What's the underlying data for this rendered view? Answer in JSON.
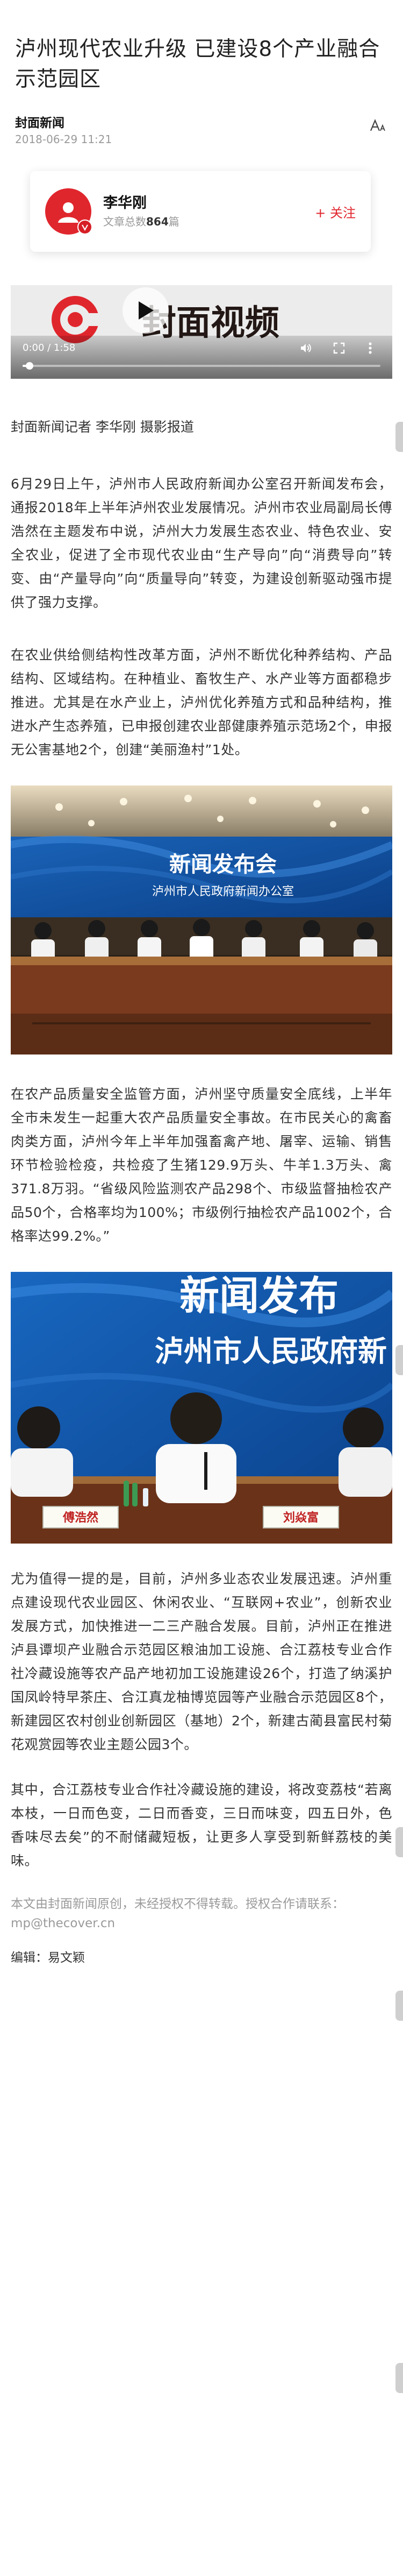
{
  "article": {
    "title": "泸州现代农业升级 已建设8个产业融合示范园区",
    "source": "封面新闻",
    "date": "2018-06-29 11:21"
  },
  "author_card": {
    "name": "李华刚",
    "article_count_prefix": "文章总数",
    "article_count": "864",
    "article_count_suffix": "篇",
    "follow_label": "+ 关注"
  },
  "video": {
    "logo_text": "封面视频",
    "time": "0:00 / 1:58",
    "progress": 0.02,
    "icons": [
      "play-icon",
      "volume-icon",
      "fullscreen-icon",
      "more-vertical-icon"
    ]
  },
  "body": {
    "reporter_line": "封面新闻记者 李华刚 摄影报道",
    "paragraphs": [
      "6月29日上午，泸州市人民政府新闻办公室召开新闻发布会，通报2018年上半年泸州农业发展情况。泸州市农业局副局长傅浩然在主题发布中说，泸州大力发展生态农业、特色农业、安全农业，促进了全市现代农业由“生产导向”向“消费导向”转变、由“产量导向”向“质量导向”转变，为建设创新驱动强市提供了强力支撑。",
      "在农业供给侧结构性改革方面，泸州不断优化种养结构、产品结构、区域结构。在种植业、畜牧生产、水产业等方面都稳步推进。尤其是在水产业上，泸州优化养殖方式和品种结构，推进水产生态养殖，已申报创建农业部健康养殖示范场2个，申报无公害基地2个，创建“美丽渔村”1处。",
      "在农产品质量安全监管方面，泸州坚守质量安全底线，上半年全市未发生一起重大农产品质量安全事故。在市民关心的禽畜肉类方面，泸州今年上半年加强畜禽产地、屠宰、运输、销售环节检验检疫，共检疫了生猪129.9万头、牛羊1.3万头、禽371.8万羽。“省级风险监测农产品298个、市级监督抽检农产品50个，合格率均为100%；市级例行抽检农产品1002个，合格率达99.2%。”",
      "尤为值得一提的是，目前，泸州多业态农业发展迅速。泸州重点建设现代农业园区、休闲农业、“互联网+农业”，创新农业发展方式，加快推进一二三产融合发展。目前，泸州正在推进泸县谭坝产业融合示范园区粮油加工设施、合江荔枝专业合作社冷藏设施等农产品产地初加工设施建设26个，打造了纳溪护国凤岭特早茶庄、合江真龙柚博览园等产业融合示范园区8个，新建园区农村创业创新园区（基地）2个，新建古蔺县富民村菊花观赏园等农业主题公园3个。",
      "其中，合江荔枝专业合作社冷藏设施的建设，将改变荔枝“若离本枝，一日而色变，二日而香变，三日而味变，四五日外，色香味尽去矣”的不耐储藏短板，让更多人享受到新鲜荔枝的美味。"
    ],
    "footer_note": "本文由封面新闻原创，未经授权不得转载。授权合作请联系：mp@thecover.cn",
    "editor_line": "编辑：易文颖"
  },
  "photos": {
    "photo1": {
      "banner_title": "新闻发布会",
      "banner_subtitle": "泸州市人民政府新闻办公室"
    },
    "photo2": {
      "banner_title": "新闻发布",
      "banner_subtitle": "泸州市人民政府新",
      "nameplate_left": "傅浩然",
      "nameplate_right": "刘焱富"
    }
  },
  "colors": {
    "accent": "#e0262d",
    "text": "#333333",
    "muted": "#9a9a9a",
    "banner_blue": "#0d4d9e"
  }
}
